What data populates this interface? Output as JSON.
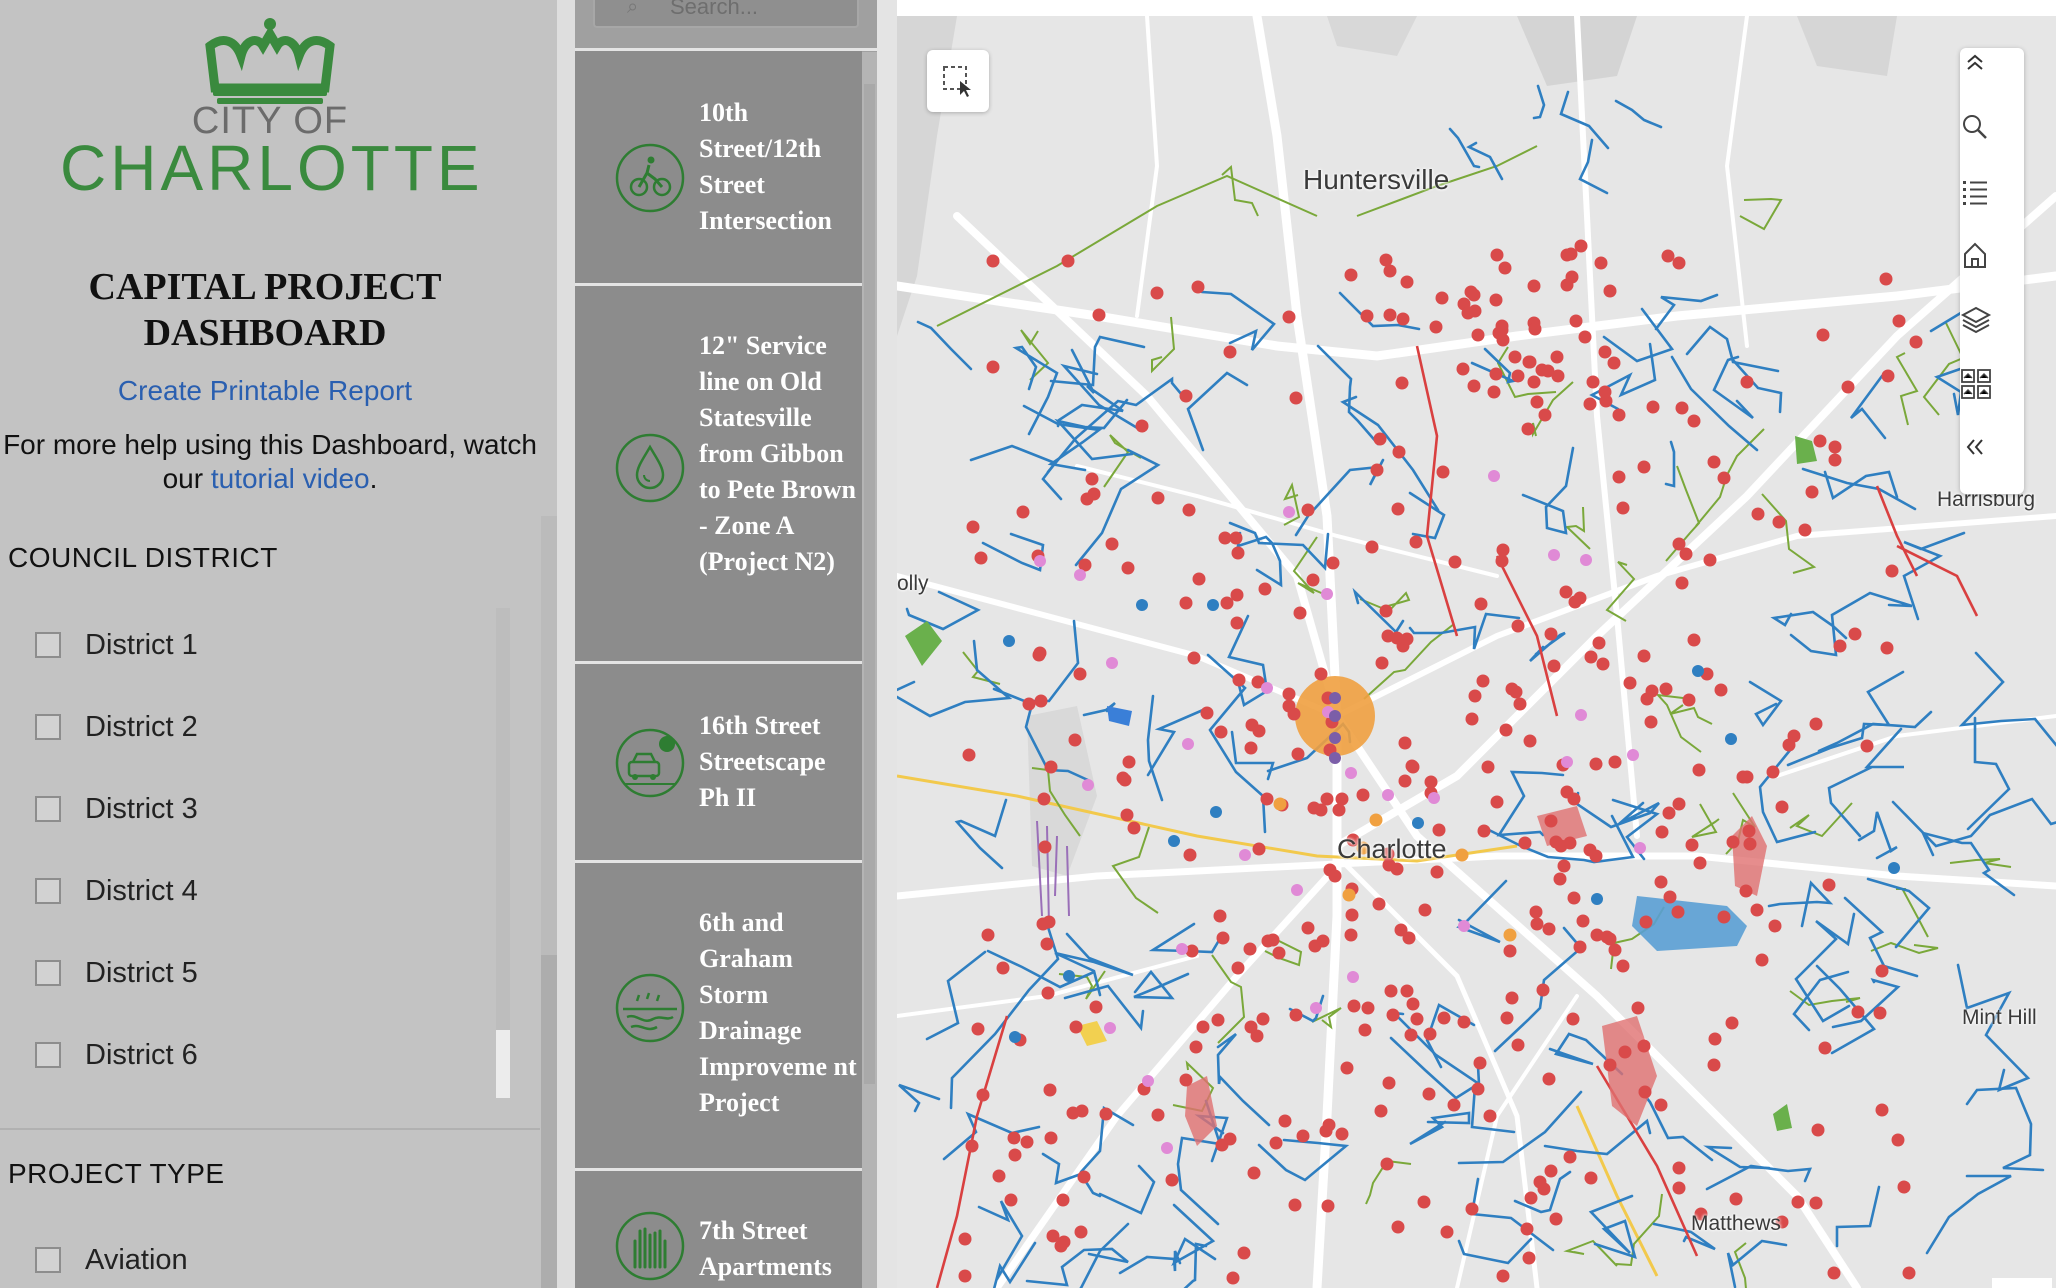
{
  "logo": {
    "city_of": "CITY OF",
    "charlotte": "CHARLOTTE",
    "accent": "#3a8a3e"
  },
  "header": {
    "title_line1": "CAPITAL PROJECT",
    "title_line2": "DASHBOARD",
    "report_link": "Create Printable Report",
    "help_prefix": "For more help using this Dashboard, watch our",
    "help_link": "tutorial video",
    "help_suffix": "."
  },
  "filters": {
    "council_district": {
      "title": "COUNCIL DISTRICT",
      "items": [
        "District 1",
        "District 2",
        "District 3",
        "District 4",
        "District 5",
        "District 6"
      ]
    },
    "project_type": {
      "title": "PROJECT TYPE",
      "items": [
        "Aviation"
      ]
    }
  },
  "search": {
    "placeholder": "Search..."
  },
  "projects": [
    {
      "name": "10th Street/12th Street Intersection",
      "icon": "bicycle-icon"
    },
    {
      "name": "12\" Service line on Old Statesville from Gibbon to Pete Brown - Zone A (Project N2)",
      "icon": "water-drop-icon"
    },
    {
      "name": "16th Street Streetscape Ph II",
      "icon": "streetscape-car-tree-icon"
    },
    {
      "name": "6th and Graham Storm Drainage Improveme nt Project",
      "icon": "storm-drainage-icon"
    },
    {
      "name": "7th Street Apartments",
      "icon": "hands-housing-icon"
    }
  ],
  "map": {
    "labels": {
      "huntersville": "Huntersville",
      "harrisburg": "Harrisburg",
      "charlotte": "Charlotte",
      "mint_hill": "Mint Hill",
      "matthews": "Matthews",
      "holly": "olly"
    },
    "toolbar": [
      "collapse-up-icon",
      "search-icon",
      "legend-list-icon",
      "home-icon",
      "layers-icon",
      "basemap-gallery-icon",
      "collapse-left-icon"
    ],
    "colors": {
      "project_point": "#d94a4a",
      "pink_point": "#e08ad6",
      "blue_line": "#2f7fc1",
      "water": "#6a9fd8",
      "road": "#ffffff",
      "yellow_route": "#f2c94c",
      "red_line": "#d94040",
      "green_line": "#7aa83a",
      "orange": "#f0a040",
      "green_area": "#6ab04c"
    }
  }
}
